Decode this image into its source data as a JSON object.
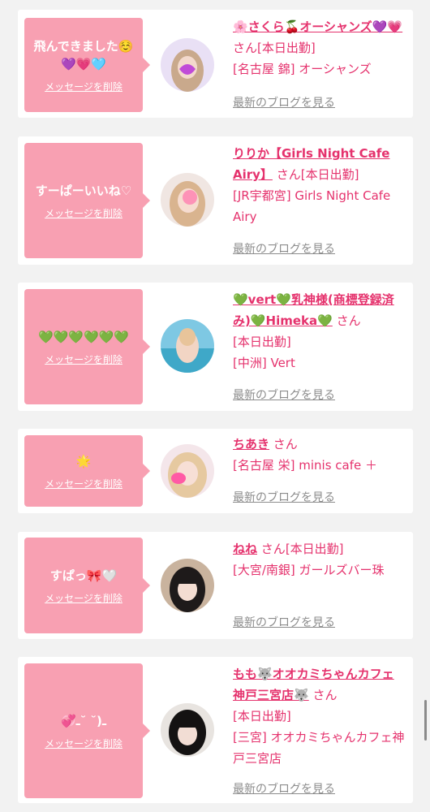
{
  "items": [
    {
      "message": "飛んできました☺️\n💜💗🩵",
      "delete_label": "メッセージを削除",
      "name": "🌸さくら🍒オーシャンズ💜💗",
      "san": "さん",
      "status": "[本日出勤]",
      "location": "[名古屋 錦] オーシャンズ",
      "blog_label": "最新のブログを見る"
    },
    {
      "message": "すーぱーいいね♡",
      "delete_label": "メッセージを削除",
      "name": "りりか【Girls Night Cafe Airy】",
      "san": "さん",
      "status": "[本日出勤]",
      "location": "[JR宇都宮] Girls Night Cafe Airy",
      "blog_label": "最新のブログを見る"
    },
    {
      "message": "💚💚💚💚💚💚",
      "delete_label": "メッセージを削除",
      "name": "💚vert💚乳神様(商標登録済み)💚Himeka💚",
      "san": "さん",
      "status": "[本日出勤]",
      "location": "[中洲] Vert",
      "blog_label": "最新のブログを見る"
    },
    {
      "message": "🌟",
      "delete_label": "メッセージを削除",
      "name": "ちあき",
      "san": "さん",
      "status": "",
      "location": "[名古屋 栄] minis cafe ＋",
      "blog_label": "最新のブログを見る"
    },
    {
      "message": "すぱっ🎀🤍",
      "delete_label": "メッセージを削除",
      "name": "ねね",
      "san": "さん",
      "status": "[本日出勤]",
      "location": "[大宮/南銀] ガールズバー珠",
      "blog_label": "最新のブログを見る"
    },
    {
      "message": "💞ـ(˘ ˘ـ",
      "delete_label": "メッセージを削除",
      "name": "もも🐺オオカミちゃんカフェ神戸三宮店🐺",
      "san": "さん",
      "status": "[本日出勤]",
      "location": "[三宮] オオカミちゃんカフェ神戸三宮店",
      "blog_label": "最新のブログを見る"
    }
  ],
  "colors": {
    "accent": "#e5326d",
    "bubble": "#f8a0b2",
    "link_gray": "#8c8c8c",
    "background": "#f2f2f2"
  }
}
